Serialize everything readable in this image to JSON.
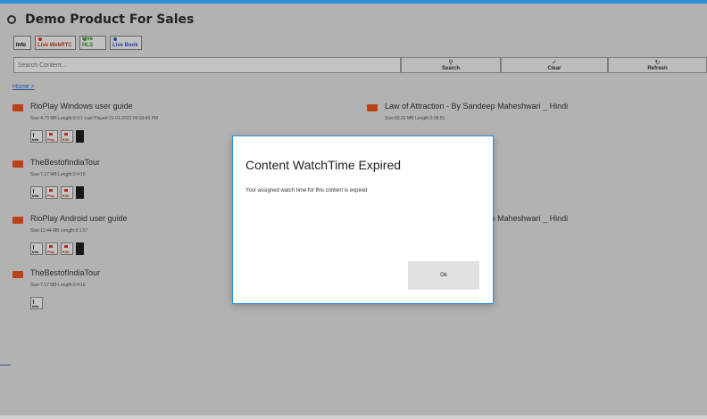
{
  "app": {
    "title": "Demo Product For Sales"
  },
  "toolbar": {
    "items": [
      {
        "label": "Info",
        "dot": ""
      },
      {
        "label": "Live WebRTC",
        "dot": "#d9391e",
        "color": "#c63a1b"
      },
      {
        "label": "Live HLS",
        "dot": "#3aa33a",
        "color": "#2b8a2b"
      },
      {
        "label": "Live Book",
        "dot": "#2a52c8",
        "color": "#2a52c8"
      }
    ]
  },
  "search": {
    "placeholder": "Search Content...",
    "buttons": {
      "search": "Search",
      "clear": "Clear",
      "refresh": "Refresh"
    }
  },
  "breadcrumb": "Home >",
  "content": {
    "items": [
      {
        "name": "RioPlay Windows user guide",
        "meta": "Size:4.73 MB  Length:0:3:1  Last Played:21-01-2022 06:03:49 PM",
        "actions": [
          "Info",
          "Play",
          "Edit",
          "dark"
        ]
      },
      {
        "name": "TheBestofIndiaTour",
        "meta": "Size:7.17 MB  Length:0:4:16",
        "actions": [
          "Info",
          "Play",
          "Edit",
          "dark"
        ]
      },
      {
        "name": "RioPlay Android user guide",
        "meta": "Size:13.44 MB  Length:0:1:57",
        "actions": [
          "Info",
          "Play",
          "Edit",
          "dark"
        ]
      },
      {
        "name": "TheBestofIndiaTour",
        "meta": "Size:7.17 MB  Length:0:4:16",
        "actions": [
          "Info"
        ]
      },
      {
        "name": "Law of Attraction - By Sandeep Maheshwari _ Hindi",
        "meta": "Size:83.02 MB  Length:0:38:51",
        "actions": []
      },
      {
        "name": "Law of Attraction - By Sandeep Maheshwari _ Hindi",
        "meta": "",
        "actions": []
      }
    ]
  },
  "dialog": {
    "title": "Content WatchTime Expired",
    "message": "Your assigned watch time for this content is expired",
    "ok": "Ok"
  }
}
